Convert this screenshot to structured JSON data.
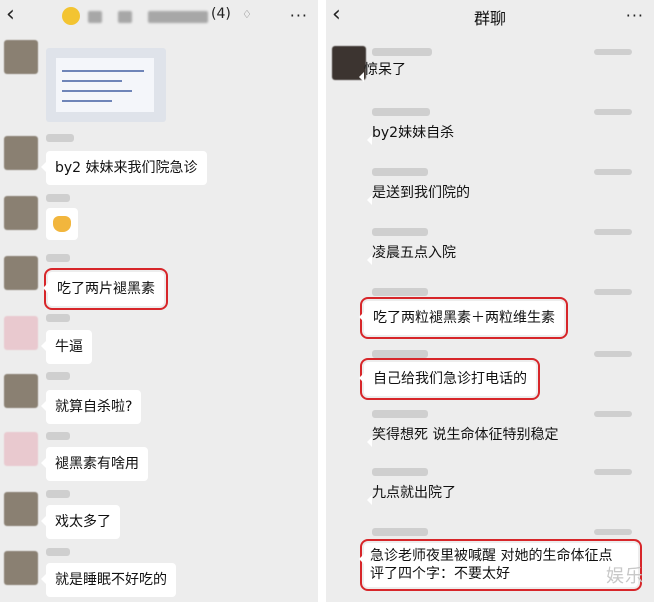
{
  "left_chat": {
    "header": {
      "member_count": "(4)"
    },
    "messages": [
      "by2 妹妹来我们院急诊",
      "吃了两片褪黑素",
      "牛逼",
      "就算自杀啦?",
      "褪黑素有啥用",
      "戏太多了",
      "就是睡眠不好吃的"
    ]
  },
  "right_chat": {
    "header": {
      "title": "群聊"
    },
    "messages": [
      "惊呆了",
      "by2妹妹自杀",
      "是送到我们院的",
      "凌晨五点入院",
      "吃了两粒褪黑素＋两粒维生素",
      "自己给我们急诊打电话的",
      "笑得想死 说生命体征特别稳定",
      "九点就出院了",
      "急诊老师夜里被喊醒 对她的生命体征点评了四个字：不要太好"
    ],
    "message_line_2": "评了四个字：不要太好",
    "message_line_1": "急诊老师夜里被喊醒 对她的生命体征点"
  },
  "watermark": "娱乐",
  "icons": {
    "back": "‹",
    "more": "···"
  }
}
